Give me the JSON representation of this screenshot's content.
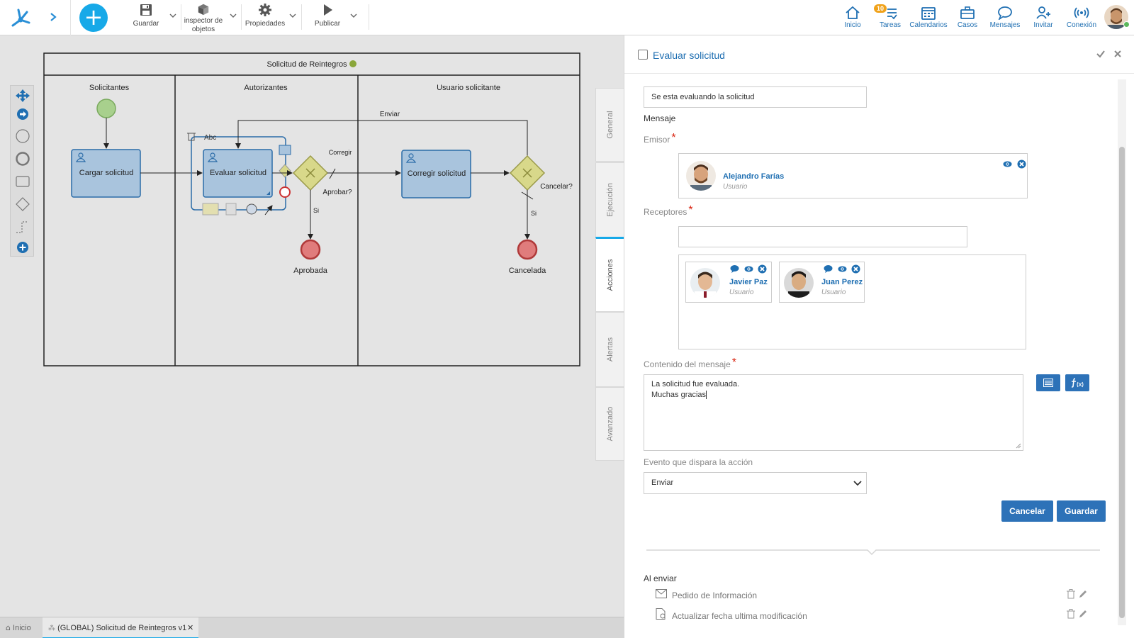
{
  "toolbar": {
    "guardar": "Guardar",
    "inspector_line1": "inspector de",
    "inspector_line2": "objetos",
    "propiedades": "Propiedades",
    "publicar": "Publicar"
  },
  "nav": {
    "inicio": "Inicio",
    "tareas": "Tareas",
    "tareas_badge": "10",
    "calendarios": "Calendarios",
    "casos": "Casos",
    "mensajes": "Mensajes",
    "invitar": "Invitar",
    "conexion": "Conexión"
  },
  "diagram": {
    "pool_title": "Solicitud de Reintegros",
    "lanes": [
      "Solicitantes",
      "Autorizantes",
      "Usuario solicitante"
    ],
    "tasks": [
      "Cargar solicitud",
      "Evaluar solicitud",
      "Corregir solicitud"
    ],
    "gateways": [
      "Aprobar?",
      "Cancelar?"
    ],
    "flows": [
      "Enviar",
      "Corregir",
      "Si",
      "Si"
    ],
    "end_events": [
      "Aprobada",
      "Cancelada"
    ],
    "text_tool": "Abc"
  },
  "side_tabs": [
    "General",
    "Ejecución",
    "Acciones",
    "Alertas",
    "Avanzado"
  ],
  "bottom_tabs": {
    "home": "Inicio",
    "process": "(GLOBAL) Solicitud de Reintegros v1"
  },
  "panel": {
    "title": "Evaluar solicitud",
    "subject_value": "Se esta evaluando la solicitud",
    "mensaje_label": "Mensaje",
    "emisor_label": "Emisor",
    "emisor": {
      "name": "Alejandro Farías",
      "role": "Usuario"
    },
    "receptores_label": "Receptores",
    "receptores_input": "",
    "receptores": [
      {
        "name": "Javier Paz",
        "role": "Usuario"
      },
      {
        "name": "Juan Perez",
        "role": "Usuario"
      }
    ],
    "contenido_label": "Contenido del mensaje",
    "contenido_line1": "La solicitud fue evaluada.",
    "contenido_line2": "Muchas gracias",
    "evento_label": "Evento que dispara la acción",
    "evento_value": "Enviar",
    "cancel_button": "Cancelar",
    "save_button": "Guardar",
    "al_enviar_label": "Al enviar",
    "actions": [
      "Pedido de Información",
      "Actualizar fecha ultima modificación"
    ],
    "required_mark": "*"
  },
  "colors": {
    "accent": "#17a9e8",
    "link": "#1f6fb2",
    "button": "#2d72b8",
    "task_fill": "#a9c4dd",
    "gateway_fill": "#d8d88a",
    "end_event": "#e07c7c",
    "start_event": "#a8d08d"
  }
}
